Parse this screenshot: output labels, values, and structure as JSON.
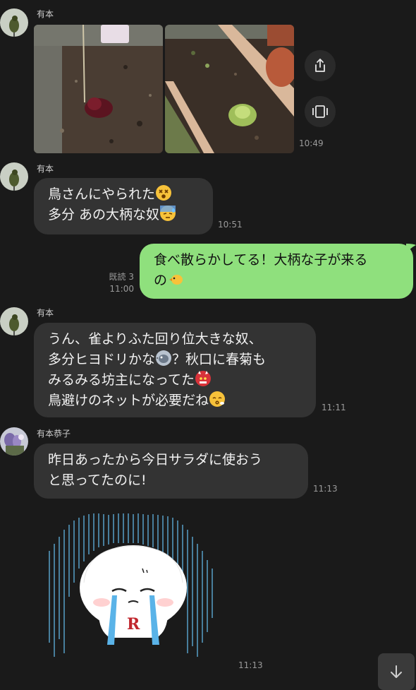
{
  "messages": [
    {
      "sender": "有本",
      "time": "10:49",
      "type": "photos"
    },
    {
      "sender": "有本",
      "time": "10:51",
      "lines": [
        "鳥さんにやられた",
        "多分 あの大柄な奴"
      ]
    },
    {
      "read": "既読 3",
      "time": "11:00",
      "lines": [
        "食べ散らかしてる！大柄な子が来る",
        "の"
      ]
    },
    {
      "sender": "有本",
      "time": "11:11",
      "lines": [
        "うん、雀よりふた回り位大きな奴、",
        "多分ヒヨドリかな",
        "？秋口に春菊も",
        "みるみる坊主になってた",
        "鳥避けのネットが必要だね"
      ]
    },
    {
      "sender": "有本恭子",
      "time": "11:13",
      "lines": [
        "昨日あったから今日サラダに使おう",
        "と思ってたのに!"
      ]
    },
    {
      "time": "11:13",
      "type": "sticker",
      "sticker_letter": "R"
    }
  ],
  "icons": {
    "share": "share-icon",
    "slideshow": "slideshow-icon",
    "scroll_down": "arrow-down-icon"
  },
  "colors": {
    "background": "#1a1a1a",
    "bubble_other": "#333333",
    "bubble_me": "#8fe07d"
  }
}
